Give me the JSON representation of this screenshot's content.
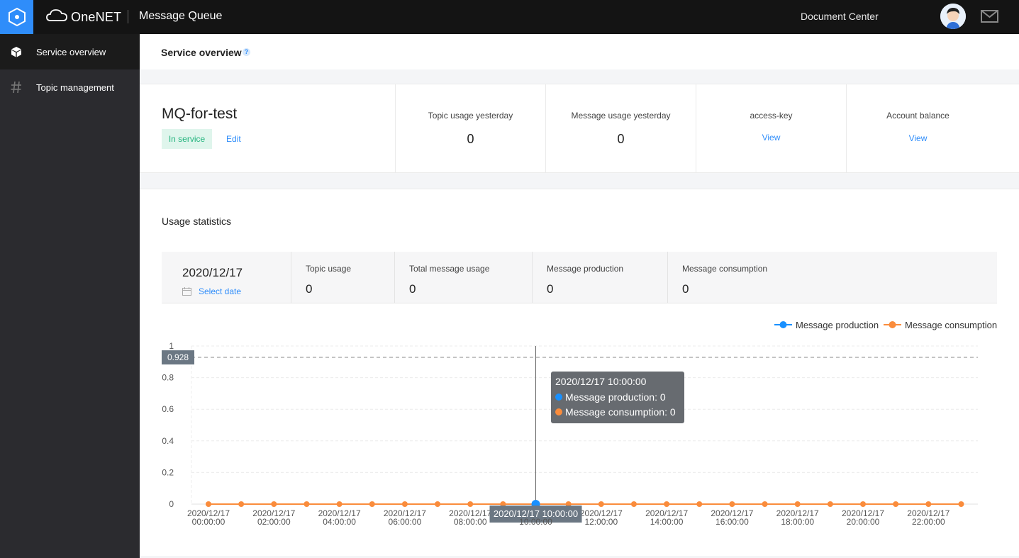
{
  "topbar": {
    "brand": "OneNET",
    "app_title": "Message Queue",
    "doc_center": "Document Center"
  },
  "sidebar": {
    "items": [
      {
        "label": "Service overview",
        "icon": "cube-icon",
        "active": true
      },
      {
        "label": "Topic management",
        "icon": "hash-icon",
        "active": false
      }
    ]
  },
  "header": {
    "title": "Service overview",
    "help": "?"
  },
  "summary": {
    "service_name": "MQ-for-test",
    "status": "In service",
    "edit_label": "Edit",
    "columns": [
      {
        "title": "Topic usage yesterday",
        "value": "0"
      },
      {
        "title": "Message usage yesterday",
        "value": "0"
      },
      {
        "title": "access-key",
        "link": "View"
      },
      {
        "title": "Account balance",
        "link": "View"
      }
    ]
  },
  "usage": {
    "title": "Usage statistics",
    "date": "2020/12/17",
    "select_date": "Select date",
    "stats": [
      {
        "title": "Topic usage",
        "value": "0"
      },
      {
        "title": "Total message usage",
        "value": "0"
      },
      {
        "title": "Message production",
        "value": "0"
      },
      {
        "title": "Message consumption",
        "value": "0"
      }
    ]
  },
  "colors": {
    "accent": "#2f8dfa",
    "production": "#1890ff",
    "consumption": "#fa8c3c",
    "status_green": "#24b47e"
  },
  "chart_data": {
    "type": "line",
    "y_ticks": [
      "0",
      "0.2",
      "0.4",
      "0.6",
      "0.8",
      "1"
    ],
    "ylim": [
      0,
      1
    ],
    "x_tick_labels": [
      "2020/12/17 00:00:00",
      "2020/12/17 02:00:00",
      "2020/12/17 04:00:00",
      "2020/12/17 06:00:00",
      "2020/12/17 08:00:00",
      "2020/12/17 10:00:00",
      "2020/12/17 12:00:00",
      "2020/12/17 14:00:00",
      "2020/12/17 16:00:00",
      "2020/12/17 18:00:00",
      "2020/12/17 20:00:00",
      "2020/12/17 22:00:00"
    ],
    "series": [
      {
        "name": "Message production",
        "color": "#1890ff",
        "values": [
          0,
          0,
          0,
          0,
          0,
          0,
          0,
          0,
          0,
          0,
          0,
          0,
          0,
          0,
          0,
          0,
          0,
          0,
          0,
          0,
          0,
          0,
          0,
          0
        ]
      },
      {
        "name": "Message consumption",
        "color": "#fa8c3c",
        "values": [
          0,
          0,
          0,
          0,
          0,
          0,
          0,
          0,
          0,
          0,
          0,
          0,
          0,
          0,
          0,
          0,
          0,
          0,
          0,
          0,
          0,
          0,
          0,
          0
        ]
      }
    ],
    "legend": "top-right",
    "grid": true,
    "crosshair": {
      "y_label": "0.928",
      "y_value": 0.928,
      "x_index": 10,
      "x_label": "2020/12/17 10:00:00"
    },
    "tooltip": {
      "title": "2020/12/17 10:00:00",
      "lines": [
        "Message production: 0",
        "Message consumption: 0"
      ]
    }
  }
}
